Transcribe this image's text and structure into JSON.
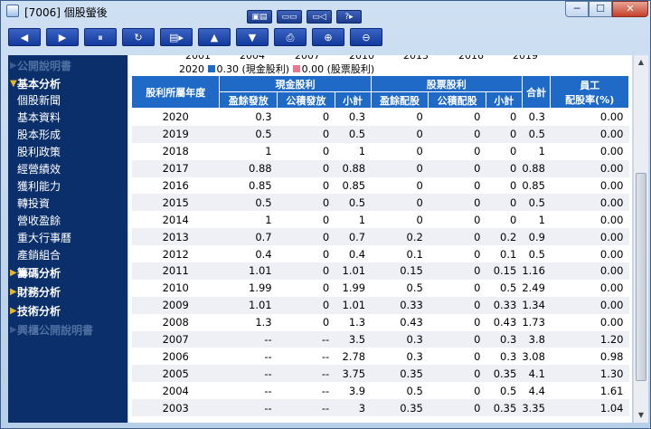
{
  "window": {
    "title": "[7006] 個股螢後"
  },
  "title_buttons": [
    "▣▤",
    "▭▭",
    "▭◁",
    "?▸"
  ],
  "window_controls": {
    "min": "─",
    "max": "☐",
    "close": "✕"
  },
  "toolbar": [
    {
      "name": "prev-button",
      "glyph": "◀"
    },
    {
      "name": "next-button",
      "glyph": "▶"
    },
    {
      "name": "pause-button",
      "glyph": "⏸"
    },
    {
      "name": "refresh-button",
      "glyph": "↻"
    },
    {
      "name": "export-button",
      "glyph": "▤▸"
    },
    {
      "name": "up-button",
      "glyph": "▲"
    },
    {
      "name": "down-button",
      "glyph": "▼"
    },
    {
      "name": "print-button",
      "glyph": "⎙"
    },
    {
      "name": "zoom-in-button",
      "glyph": "⊕"
    },
    {
      "name": "zoom-out-button",
      "glyph": "⊖"
    }
  ],
  "sidebar": {
    "top_dim": "公開說明書",
    "section1": "基本分析",
    "subitems": [
      "個股新聞",
      "基本資料",
      "股本形成",
      "股利政策",
      "經營績效",
      "獲利能力",
      "轉投資",
      "營收盈餘",
      "重大行事曆",
      "產銷組合"
    ],
    "section2": "籌碼分析",
    "section3": "財務分析",
    "section4": "技術分析",
    "bottom_dim": "興櫃公開說明書"
  },
  "chart_head": {
    "x_ticks": [
      "2001",
      "2004",
      "2007",
      "2010",
      "2013",
      "2016",
      "2019"
    ],
    "legend_year": "2020",
    "legend_cash": "0.30 (現金股利)",
    "legend_stock": "0.00 (股票股利)",
    "cash_color": "#1e6ac6",
    "stock_color": "#e87a90"
  },
  "table": {
    "h_year": "股利所屬年度",
    "h_cash": "現金股利",
    "h_stock": "股票股利",
    "h_total": "合計",
    "h_emp1": "員工",
    "h_emp2": "配股率(%)",
    "h_cash_earn": "盈餘發放",
    "h_cash_cap": "公積發放",
    "h_cash_sub": "小計",
    "h_stock_earn": "盈餘配股",
    "h_stock_cap": "公積配股",
    "h_stock_sub": "小計",
    "rows": [
      [
        "2020",
        "0.3",
        "0",
        "0.3",
        "0",
        "0",
        "0",
        "0.3",
        "0.00"
      ],
      [
        "2019",
        "0.5",
        "0",
        "0.5",
        "0",
        "0",
        "0",
        "0.5",
        "0.00"
      ],
      [
        "2018",
        "1",
        "0",
        "1",
        "0",
        "0",
        "0",
        "1",
        "0.00"
      ],
      [
        "2017",
        "0.88",
        "0",
        "0.88",
        "0",
        "0",
        "0",
        "0.88",
        "0.00"
      ],
      [
        "2016",
        "0.85",
        "0",
        "0.85",
        "0",
        "0",
        "0",
        "0.85",
        "0.00"
      ],
      [
        "2015",
        "0.5",
        "0",
        "0.5",
        "0",
        "0",
        "0",
        "0.5",
        "0.00"
      ],
      [
        "2014",
        "1",
        "0",
        "1",
        "0",
        "0",
        "0",
        "1",
        "0.00"
      ],
      [
        "2013",
        "0.7",
        "0",
        "0.7",
        "0.2",
        "0",
        "0.2",
        "0.9",
        "0.00"
      ],
      [
        "2012",
        "0.4",
        "0",
        "0.4",
        "0.1",
        "0",
        "0.1",
        "0.5",
        "0.00"
      ],
      [
        "2011",
        "1.01",
        "0",
        "1.01",
        "0.15",
        "0",
        "0.15",
        "1.16",
        "0.00"
      ],
      [
        "2010",
        "1.99",
        "0",
        "1.99",
        "0.5",
        "0",
        "0.5",
        "2.49",
        "0.00"
      ],
      [
        "2009",
        "1.01",
        "0",
        "1.01",
        "0.33",
        "0",
        "0.33",
        "1.34",
        "0.00"
      ],
      [
        "2008",
        "1.3",
        "0",
        "1.3",
        "0.43",
        "0",
        "0.43",
        "1.73",
        "0.00"
      ],
      [
        "2007",
        "--",
        "--",
        "3.5",
        "0.3",
        "0",
        "0.3",
        "3.8",
        "1.20"
      ],
      [
        "2006",
        "--",
        "--",
        "2.78",
        "0.3",
        "0",
        "0.3",
        "3.08",
        "0.98"
      ],
      [
        "2005",
        "--",
        "--",
        "3.75",
        "0.35",
        "0",
        "0.35",
        "4.1",
        "1.30"
      ],
      [
        "2004",
        "--",
        "--",
        "3.9",
        "0.5",
        "0",
        "0.5",
        "4.4",
        "1.61"
      ],
      [
        "2003",
        "--",
        "--",
        "3",
        "0.35",
        "0",
        "0.35",
        "3.35",
        "1.04"
      ]
    ]
  },
  "scrollbar": {
    "up": "▲",
    "down": "▼"
  }
}
